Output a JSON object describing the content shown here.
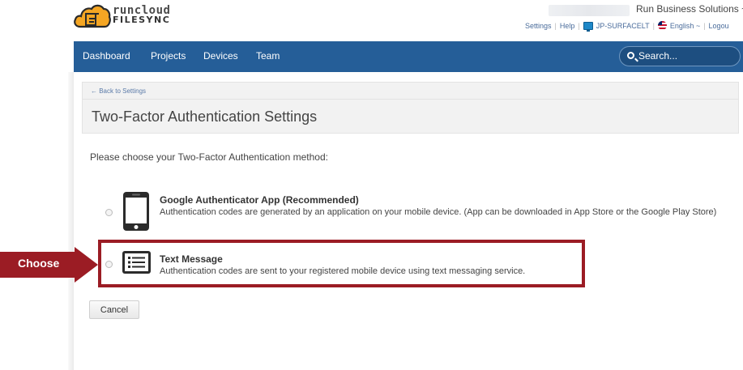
{
  "header": {
    "logo_top": "runcloud",
    "logo_bottom": "FILESYNC",
    "company": "Run Business Solutions ~",
    "links": {
      "settings": "Settings",
      "help": "Help",
      "device": "JP-SURFACELT",
      "language": "English ~",
      "logout": "Logou",
      "sep": "|"
    }
  },
  "nav": {
    "items": [
      "Dashboard",
      "Projects",
      "Devices",
      "Team"
    ],
    "search_placeholder": "Search..."
  },
  "panel": {
    "back_link": "← Back to Settings",
    "title": "Two-Factor Authentication Settings"
  },
  "prompt": "Please choose your Two-Factor Authentication method:",
  "options": [
    {
      "title": "Google Authenticator App (Recommended)",
      "description": "Authentication codes are generated by an application on your mobile device. (App can be downloaded in App Store or the Google Play Store)",
      "icon": "smartphone-icon"
    },
    {
      "title": "Text Message",
      "description": "Authentication codes are sent to your registered mobile device using text messaging service.",
      "icon": "message-list-icon"
    }
  ],
  "annotation": {
    "label": "Choose",
    "color": "#9b1c24"
  },
  "cancel_label": "Cancel",
  "colors": {
    "nav_bg": "#255e98",
    "accent": "#9b1c24"
  }
}
